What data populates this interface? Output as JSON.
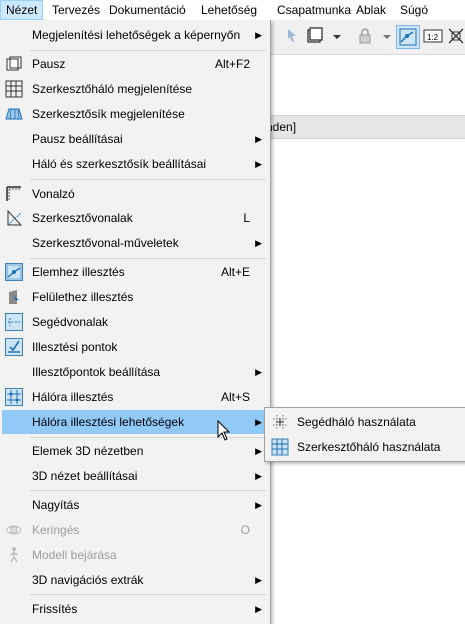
{
  "menubar": {
    "items": [
      {
        "label": "Nézet"
      },
      {
        "label": "Tervezés"
      },
      {
        "label": "Dokumentáció"
      },
      {
        "label": "Lehetőség"
      },
      {
        "label": "Csapatmunka"
      },
      {
        "label": "Ablak"
      },
      {
        "label": "Súgó"
      }
    ]
  },
  "background": {
    "header_text": "nden]"
  },
  "menu": {
    "items": [
      {
        "label": "Megjelenítési lehetőségek a képernyőn",
        "shortcut": "",
        "submenu": true
      },
      {
        "label": "Pausz",
        "shortcut": "Alt+F2"
      },
      {
        "label": "Szerkesztőháló megjelenítése",
        "shortcut": ""
      },
      {
        "label": "Szerkesztősík megjelenítése",
        "shortcut": ""
      },
      {
        "label": "Pausz beállításai",
        "shortcut": "",
        "submenu": true
      },
      {
        "label": "Háló és szerkesztősík beállításai",
        "shortcut": "",
        "submenu": true
      },
      {
        "label": "Vonalzó",
        "shortcut": ""
      },
      {
        "label": "Szerkesztővonalak",
        "shortcut": "L"
      },
      {
        "label": "Szerkesztővonal-műveletek",
        "shortcut": "",
        "submenu": true
      },
      {
        "label": "Elemhez illesztés",
        "shortcut": "Alt+E"
      },
      {
        "label": "Felülethez illesztés",
        "shortcut": ""
      },
      {
        "label": "Segédvonalak",
        "shortcut": ""
      },
      {
        "label": "Illesztési pontok",
        "shortcut": ""
      },
      {
        "label": "Illesztőpontok beállítása",
        "shortcut": "",
        "submenu": true
      },
      {
        "label": "Hálóra illesztés",
        "shortcut": "Alt+S"
      },
      {
        "label": "Hálóra illesztési lehetőségek",
        "shortcut": "",
        "submenu": true
      },
      {
        "label": "Elemek 3D nézetben",
        "shortcut": "",
        "submenu": true
      },
      {
        "label": "3D nézet beállításai",
        "shortcut": "",
        "submenu": true
      },
      {
        "label": "Nagyítás",
        "shortcut": "",
        "submenu": true
      },
      {
        "label": "Keringés",
        "shortcut": "O"
      },
      {
        "label": "Modell bejárása",
        "shortcut": ""
      },
      {
        "label": "3D navigációs extrák",
        "shortcut": "",
        "submenu": true
      },
      {
        "label": "Frissítés",
        "shortcut": "",
        "submenu": true
      }
    ]
  },
  "submenu": {
    "items": [
      {
        "label": "Segédháló használata"
      },
      {
        "label": "Szerkesztőháló használata"
      }
    ]
  },
  "colors": {
    "highlight": "#91c9f7",
    "menu_bg": "#f2f2f2",
    "check_bg": "#cce4f7",
    "check_border": "#3c7fb1",
    "icon_blue": "#1f6fb2"
  }
}
